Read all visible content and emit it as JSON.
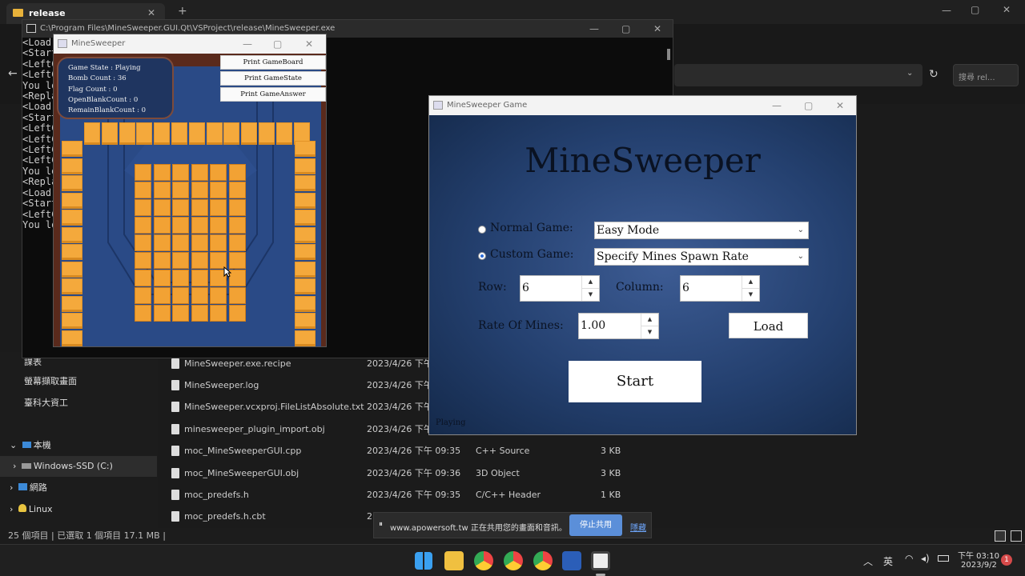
{
  "explorer": {
    "tab_label": "release",
    "search_placeholder": "搜尋 rel...",
    "nav_items": [
      "課表",
      "螢幕擷取畫面",
      "臺科大資工",
      "本機",
      "Windows-SSD (C:)",
      "網路",
      "Linux"
    ],
    "files": [
      {
        "name": "MineSweeper.exe.recipe",
        "date": "2023/4/26 下午 0",
        "type": "",
        "size": ""
      },
      {
        "name": "MineSweeper.log",
        "date": "2023/4/26 下午 0",
        "type": "",
        "size": ""
      },
      {
        "name": "MineSweeper.vcxproj.FileListAbsolute.txt",
        "date": "2023/4/26 下午 0",
        "type": "",
        "size": ""
      },
      {
        "name": "minesweeper_plugin_import.obj",
        "date": "2023/4/26 下午 0",
        "type": "",
        "size": ""
      },
      {
        "name": "moc_MineSweeperGUI.cpp",
        "date": "2023/4/26 下午 09:35",
        "type": "C++ Source",
        "size": "3 KB"
      },
      {
        "name": "moc_MineSweeperGUI.obj",
        "date": "2023/4/26 下午 09:36",
        "type": "3D Object",
        "size": "3 KB"
      },
      {
        "name": "moc_predefs.h",
        "date": "2023/4/26 下午 09:35",
        "type": "C/C++ Header",
        "size": "1 KB"
      },
      {
        "name": "moc_predefs.h.cbt",
        "date": "2",
        "type": "",
        "size": ""
      }
    ],
    "status": "25 個項目  |  已選取 1 個項目 17.1 MB  |"
  },
  "console": {
    "title": "C:\\Program Files\\MineSweeper.GUI.Qt\\VSProject\\release\\MineSweeper.exe",
    "lines": "<Load\n<Start\n<LeftC\n<LeftC\nYou lo\n<Repla\n<Load\n<Start\n<LeftC\n<LeftC\n<LeftC\n<LeftC\nYou lo\n<Repla\n<Load\n<Start\n<LeftC\nYou lo"
  },
  "game_window": {
    "title": "MineSweeper",
    "info": {
      "state": "Game State : Playing",
      "bombs": "Bomb Count : 36",
      "flags": "Flag Count : 0",
      "open": "OpenBlankCount : 0",
      "remain": "RemainBlankCount : 0"
    },
    "buttons": [
      "Print GameBoard",
      "Print GameState",
      "Print GameAnswer"
    ]
  },
  "dialog": {
    "title": "MineSweeper Game",
    "heading": "MineSweeper",
    "normal_label": "Normal Game:",
    "normal_value": "Easy Mode",
    "custom_label": "Custom Game:",
    "custom_value": "Specify Mines Spawn Rate",
    "row_label": "Row:",
    "row_value": "6",
    "col_label": "Column:",
    "col_value": "6",
    "rate_label": "Rate Of Mines:",
    "rate_value": "1.00",
    "load": "Load",
    "start": "Start",
    "status": "Playing"
  },
  "sharebar": {
    "text": "www.apowersoft.tw 正在共用您的畫面和音訊。",
    "stop": "停止共用",
    "hide": "隱藏"
  },
  "taskbar": {
    "lang": "英",
    "time": "下午 03:10",
    "date": "2023/9/2",
    "badge": "1"
  },
  "colors": {
    "accent": "#2b6cd8",
    "tile": "#f2a234",
    "board": "#2a4a86"
  }
}
